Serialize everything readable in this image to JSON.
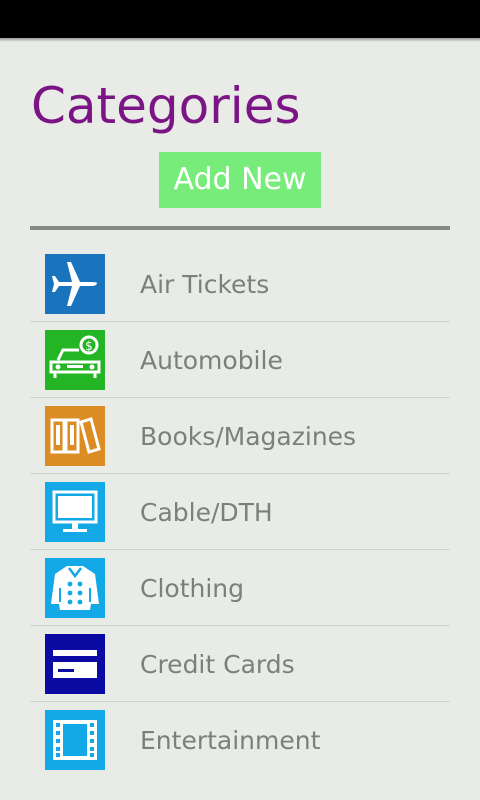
{
  "header": {
    "title": "Categories",
    "add_button_label": "Add New"
  },
  "colors": {
    "title": "#7b1585",
    "add_button": "#77ec7a",
    "background": "#e8ebe6"
  },
  "categories": [
    {
      "label": "Air Tickets",
      "icon": "airplane-icon",
      "color": "#1a73bd"
    },
    {
      "label": "Automobile",
      "icon": "car-icon",
      "color": "#24b524"
    },
    {
      "label": "Books/Magazines",
      "icon": "books-icon",
      "color": "#db8c23"
    },
    {
      "label": "Cable/DTH",
      "icon": "monitor-icon",
      "color": "#12a9e6"
    },
    {
      "label": "Clothing",
      "icon": "jacket-icon",
      "color": "#12a9e6"
    },
    {
      "label": "Credit Cards",
      "icon": "credit-card-icon",
      "color": "#0b0aa3"
    },
    {
      "label": "Entertainment",
      "icon": "film-icon",
      "color": "#12a9e6"
    }
  ]
}
